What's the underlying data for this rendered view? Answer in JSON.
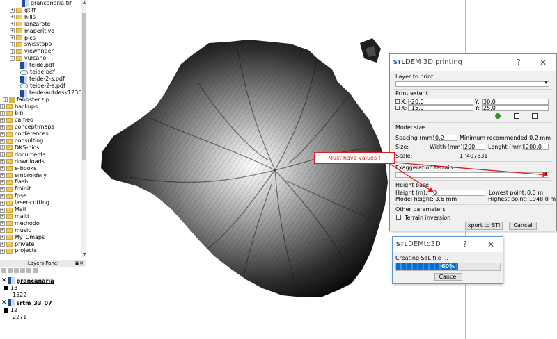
{
  "browser": {
    "items": [
      {
        "label": "grancanaria.tif",
        "icon": "raster",
        "expander": ""
      },
      {
        "label": "gtiff",
        "icon": "folder",
        "expander": "+"
      },
      {
        "label": "hills",
        "icon": "folder",
        "expander": "+"
      },
      {
        "label": "lanzarote",
        "icon": "folder",
        "expander": "+"
      },
      {
        "label": "maperitive",
        "icon": "folder",
        "expander": "+"
      },
      {
        "label": "pics",
        "icon": "folder",
        "expander": "+"
      },
      {
        "label": "swisstopo",
        "icon": "folder",
        "expander": "+"
      },
      {
        "label": "viewfinder",
        "icon": "folder",
        "expander": "+"
      },
      {
        "label": "vulcano",
        "icon": "folder",
        "expander": "-"
      },
      {
        "label": "teide.pdf",
        "icon": "raster",
        "expander": ""
      },
      {
        "label": "teide.pdf",
        "icon": "pdf",
        "expander": ""
      },
      {
        "label": "teide-2-s.pdf",
        "icon": "raster",
        "expander": ""
      },
      {
        "label": "teide-2-s.pdf",
        "icon": "pdf",
        "expander": ""
      },
      {
        "label": "teide-autdesk123D-ma",
        "icon": "raster",
        "expander": ""
      },
      {
        "label": "fabbster.zip",
        "icon": "zip",
        "expander": "+"
      },
      {
        "label": "backups",
        "icon": "folder",
        "expander": "+"
      },
      {
        "label": "bin",
        "icon": "folder",
        "expander": "+"
      },
      {
        "label": "cameo",
        "icon": "folder",
        "expander": "+"
      },
      {
        "label": "concept-maps",
        "icon": "folder",
        "expander": "+"
      },
      {
        "label": "conferences",
        "icon": "folder",
        "expander": "+"
      },
      {
        "label": "consulting",
        "icon": "folder",
        "expander": "+"
      },
      {
        "label": "DKS-pics",
        "icon": "folder",
        "expander": "+"
      },
      {
        "label": "documents",
        "icon": "folder",
        "expander": "+"
      },
      {
        "label": "downloads",
        "icon": "folder",
        "expander": "+"
      },
      {
        "label": "e-books",
        "icon": "folder",
        "expander": "+"
      },
      {
        "label": "embroidery",
        "icon": "folder",
        "expander": "+"
      },
      {
        "label": "flash",
        "icon": "folder",
        "expander": "+"
      },
      {
        "label": "fminit",
        "icon": "folder",
        "expander": "+"
      },
      {
        "label": "fpse",
        "icon": "folder",
        "expander": "+"
      },
      {
        "label": "laser-cutting",
        "icon": "folder",
        "expander": "+"
      },
      {
        "label": "Mail",
        "icon": "folder",
        "expander": "+"
      },
      {
        "label": "maltt",
        "icon": "folder",
        "expander": "+"
      },
      {
        "label": "methodo",
        "icon": "folder",
        "expander": "+"
      },
      {
        "label": "music",
        "icon": "folder",
        "expander": "+"
      },
      {
        "label": "My_Cmaps",
        "icon": "folder",
        "expander": "+"
      },
      {
        "label": "private",
        "icon": "folder",
        "expander": "+"
      },
      {
        "label": "projects",
        "icon": "folder",
        "expander": "+"
      }
    ]
  },
  "layers_panel": {
    "title": "Layers Panel",
    "layers": [
      {
        "name": "grancanaria",
        "max": "13",
        "min": "1522"
      },
      {
        "name": "srtm_33_07",
        "max": "12",
        "min": "2271"
      }
    ]
  },
  "stl_dialog": {
    "logo": "STL",
    "title": "DEM 3D printing",
    "help": "?",
    "close": "✕",
    "layer_to_print": "Layer to print",
    "print_extent": "Print extent",
    "x_label": "X:",
    "y_label": "Y:",
    "x1": "-20.0",
    "y1": "30.0",
    "x2": "-15.0",
    "y2": "25.0",
    "model_size": "Model size",
    "spacing_label": "Spacing (mm):",
    "spacing_value": "0.2",
    "min_recommended": "Minimum recommended 0.2 mm",
    "size_label": "Size:",
    "width_label": "Width (mm):",
    "width_value": "200",
    "length_label": "Lenght (mm):",
    "length_value": "200.0",
    "scale_label": "Scale:",
    "scale_value": "1:'407831",
    "exaggeration_terrain": "Exaggeration terrain",
    "height_base": "Height base",
    "height_label": "Height (m):",
    "height_value": "0",
    "lowest_point_label": "Lowest point:",
    "lowest_point_value": "0.0 m",
    "model_height_label": "Model height: 3.6 mm",
    "highest_point_label": "Highest point: 1948.0 m",
    "other_parameters": "Other parameters",
    "terrain_inversion": "Terrain inversion",
    "export_button": "xport to STl",
    "cancel_button": "Cancel"
  },
  "progress_dialog": {
    "logo": "STL",
    "title": "DEMto3D",
    "help": "?",
    "close": "✕",
    "message": "Creating STL file ...",
    "progress": 60,
    "progress_label": "60%",
    "cancel_button": "Cancel"
  },
  "annotation": {
    "text": "Must have values !",
    "color": "#e01b1b"
  },
  "colors": {
    "accent": "#1a4f9a",
    "progress": "#0a6ed1",
    "folder": "#f0c95c"
  }
}
